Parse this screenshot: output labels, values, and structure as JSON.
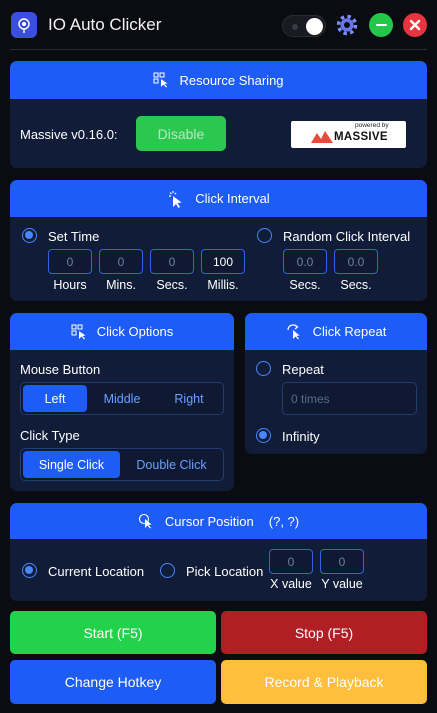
{
  "window": {
    "title": "IO Auto Clicker"
  },
  "resource": {
    "header": "Resource Sharing",
    "version_label": "Massive v0.16.0:",
    "disable_label": "Disable",
    "logo_powered": "powered by",
    "logo_name": "MASSIVE"
  },
  "interval": {
    "header": "Click Interval",
    "set_time_label": "Set Time",
    "random_label": "Random Click Interval",
    "fields": [
      {
        "value": "0",
        "label": "Hours"
      },
      {
        "value": "0",
        "label": "Mins."
      },
      {
        "value": "0",
        "label": "Secs."
      },
      {
        "value": "100",
        "label": "Millis."
      }
    ],
    "random_fields": [
      {
        "value": "0.0",
        "label": "Secs."
      },
      {
        "value": "0.0",
        "label": "Secs."
      }
    ]
  },
  "options": {
    "header": "Click Options",
    "mouse_button_label": "Mouse Button",
    "mouse_buttons": [
      "Left",
      "Middle",
      "Right"
    ],
    "click_type_label": "Click Type",
    "click_types": [
      "Single Click",
      "Double Click"
    ]
  },
  "repeat": {
    "header": "Click Repeat",
    "repeat_label": "Repeat",
    "times_placeholder": "0 times",
    "infinity_label": "Infinity"
  },
  "cursor": {
    "header": "Cursor Position",
    "coords": "(?, ?)",
    "current_label": "Current Location",
    "pick_label": "Pick Location",
    "x_value": "0",
    "y_value": "0",
    "x_label": "X value",
    "y_label": "Y value"
  },
  "actions": {
    "start": "Start (F5)",
    "stop": "Stop (F5)",
    "hotkey": "Change Hotkey",
    "record": "Record & Playback"
  },
  "colors": {
    "accent": "#1d5cf5",
    "panel": "#111d38",
    "start": "#22d24a",
    "stop": "#b01f23",
    "record": "#ffbe3b",
    "disable": "#2bc84f"
  }
}
